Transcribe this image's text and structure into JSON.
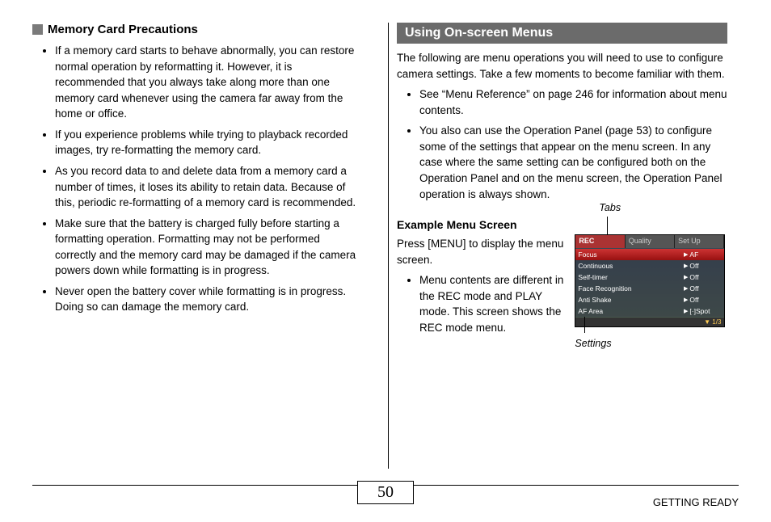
{
  "left": {
    "heading": "Memory Card Precautions",
    "bullets": [
      "If a memory card starts to behave abnormally, you can restore normal operation by reformatting it. However, it is recommended that you always take along more than one memory card whenever using the camera far away from the home or office.",
      "If you experience problems while trying to playback recorded images, try re-formatting the memory card.",
      "As you record data to and delete data from a memory card a number of times, it loses its ability to retain data. Because of this, periodic re-formatting of a memory card is recommended.",
      "Make sure that the battery is charged fully before starting a formatting operation. Formatting may not be performed correctly and the memory card may be damaged if the camera powers down while formatting is in progress.",
      "Never open the battery cover while formatting is in progress. Doing so can damage the memory card."
    ]
  },
  "right": {
    "banner": "Using On-screen Menus",
    "intro": "The following are menu operations you will need to use to configure camera settings. Take a few moments to become familiar with them.",
    "bullets": [
      "See “Menu Reference” on page 246 for information about menu contents.",
      "You also can use the Operation Panel (page 53) to configure some of the settings that appear on the menu screen. In any case where the same setting can be configured both on the Operation Panel and on the menu screen, the Operation Panel operation is always shown."
    ],
    "example": {
      "heading": "Example Menu Screen",
      "text": "Press [MENU] to display the menu screen.",
      "bullet": "Menu contents are different in the REC mode and PLAY mode. This screen shows the REC mode menu.",
      "tabs_label": "Tabs",
      "settings_label": "Settings",
      "menu": {
        "tabs": [
          "REC",
          "Quality",
          "Set Up"
        ],
        "rows": [
          {
            "label": "Focus",
            "value": "AF",
            "hl": true
          },
          {
            "label": "Continuous",
            "value": "Off",
            "hl": false
          },
          {
            "label": "Self-timer",
            "value": "Off",
            "hl": false
          },
          {
            "label": "Face Recognition",
            "value": "Off",
            "hl": false
          },
          {
            "label": "Anti Shake",
            "value": "Off",
            "hl": false
          },
          {
            "label": "AF Area",
            "value": "[·]Spot",
            "hl": false
          }
        ],
        "footer": "1/3"
      }
    }
  },
  "footer": {
    "page": "50",
    "section": "GETTING READY"
  }
}
